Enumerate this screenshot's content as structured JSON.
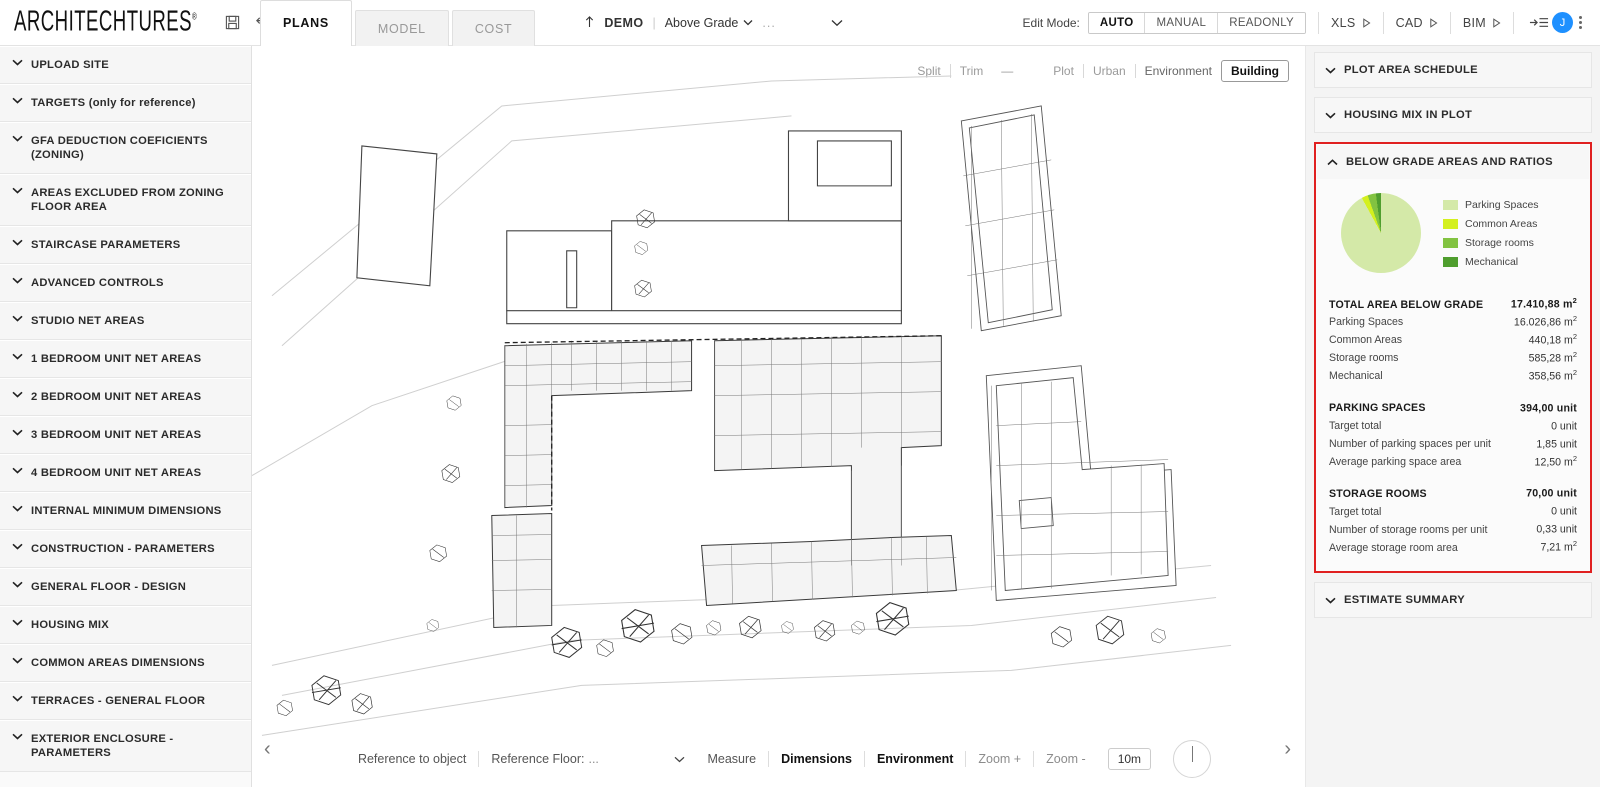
{
  "brand": {
    "name": "ARCHITECHTURES",
    "registered": "®"
  },
  "toolbar_icons": {
    "save": "save-icon",
    "undo": "undo-icon",
    "redo": "redo-icon"
  },
  "tabs": [
    {
      "label": "PLANS",
      "active": true
    },
    {
      "label": "MODEL",
      "active": false
    },
    {
      "label": "COST",
      "active": false
    }
  ],
  "project": {
    "upload_icon": "upload-arrow-icon",
    "name": "DEMO",
    "separator": "|",
    "grade": "Above Grade",
    "ellipsis": "...",
    "expand_icon": "chevron-down-icon"
  },
  "edit_mode": {
    "label": "Edit Mode:",
    "options": [
      {
        "label": "AUTO",
        "active": true
      },
      {
        "label": "MANUAL",
        "active": false
      },
      {
        "label": "READONLY",
        "active": false
      }
    ]
  },
  "exports": [
    {
      "label": "XLS"
    },
    {
      "label": "CAD"
    },
    {
      "label": "BIM"
    }
  ],
  "account": {
    "avatar_initial": "J",
    "menu_icon": "kebab-menu-icon",
    "collapse_icon": "collapse-panel-icon"
  },
  "sidebar": {
    "items": [
      {
        "label": "UPLOAD SITE"
      },
      {
        "label": "TARGETS (only for reference)"
      },
      {
        "label": "GFA DEDUCTION COEFICIENTS (ZONING)"
      },
      {
        "label": "AREAS EXCLUDED FROM ZONING FLOOR AREA"
      },
      {
        "label": "STAIRCASE PARAMETERS"
      },
      {
        "label": "ADVANCED CONTROLS"
      },
      {
        "label": "STUDIO NET AREAS"
      },
      {
        "label": "1 BEDROOM UNIT NET AREAS"
      },
      {
        "label": "2 BEDROOM UNIT NET AREAS"
      },
      {
        "label": "3 BEDROOM UNIT NET AREAS"
      },
      {
        "label": "4 BEDROOM UNIT NET AREAS"
      },
      {
        "label": "INTERNAL MINIMUM DIMENSIONS"
      },
      {
        "label": "CONSTRUCTION - PARAMETERS"
      },
      {
        "label": "GENERAL FLOOR - DESIGN"
      },
      {
        "label": "HOUSING MIX"
      },
      {
        "label": "COMMON AREAS DIMENSIONS"
      },
      {
        "label": "TERRACES - GENERAL FLOOR"
      },
      {
        "label": "EXTERIOR ENCLOSURE - PARAMETERS"
      }
    ]
  },
  "view_controls": {
    "split": "Split",
    "trim": "Trim",
    "dash": "—",
    "plot": "Plot",
    "urban": "Urban",
    "environment": "Environment",
    "building": "Building"
  },
  "bottom_bar": {
    "reference_to_object": "Reference to object",
    "reference_floor_label": "Reference Floor:",
    "reference_floor_value": "...",
    "dropdown_icon": "chevron-down-icon",
    "measure": "Measure",
    "dimensions": "Dimensions",
    "environment": "Environment",
    "zoom_in": "Zoom +",
    "zoom_out": "Zoom -",
    "scale": "10m",
    "compass": "compass-north-icon",
    "prev": "‹",
    "next": "›"
  },
  "right_panel": {
    "sections": [
      {
        "title": "PLOT AREA SCHEDULE",
        "expanded": false
      },
      {
        "title": "HOUSING MIX IN PLOT",
        "expanded": false
      },
      {
        "title": "BELOW GRADE AREAS AND RATIOS",
        "expanded": true,
        "highlighted": true
      },
      {
        "title": "ESTIMATE SUMMARY",
        "expanded": false
      }
    ],
    "below_grade": {
      "totals": {
        "header": {
          "key": "TOTAL AREA BELOW GRADE",
          "value": "17.410,88 m",
          "unit_sup": "2"
        },
        "rows": [
          {
            "key": "Parking Spaces",
            "value": "16.026,86 m",
            "unit_sup": "2"
          },
          {
            "key": "Common Areas",
            "value": "440,18 m",
            "unit_sup": "2"
          },
          {
            "key": "Storage rooms",
            "value": "585,28 m",
            "unit_sup": "2"
          },
          {
            "key": "Mechanical",
            "value": "358,56 m",
            "unit_sup": "2"
          }
        ]
      },
      "parking": {
        "header": {
          "key": "PARKING SPACES",
          "value": "394,00 unit",
          "unit_sup": ""
        },
        "rows": [
          {
            "key": "Target total",
            "value": "0 unit",
            "unit_sup": ""
          },
          {
            "key": "Number of parking spaces per unit",
            "value": "1,85 unit",
            "unit_sup": ""
          },
          {
            "key": "Average parking space area",
            "value": "12,50 m",
            "unit_sup": "2"
          }
        ]
      },
      "storage": {
        "header": {
          "key": "STORAGE ROOMS",
          "value": "70,00 unit",
          "unit_sup": ""
        },
        "rows": [
          {
            "key": "Target total",
            "value": "0 unit",
            "unit_sup": ""
          },
          {
            "key": "Number of storage rooms per unit",
            "value": "0,33 unit",
            "unit_sup": ""
          },
          {
            "key": "Average storage room area",
            "value": "7,21 m",
            "unit_sup": "2"
          }
        ]
      }
    }
  },
  "chart_data": {
    "type": "pie",
    "title": "BELOW GRADE AREAS AND RATIOS",
    "legend_position": "right",
    "categories": [
      "Parking Spaces",
      "Common Areas",
      "Storage rooms",
      "Mechanical"
    ],
    "values": [
      16026.86,
      440.18,
      585.28,
      358.56
    ],
    "unit": "m2",
    "total": 17410.88,
    "percentages": [
      92.05,
      2.53,
      3.36,
      2.06
    ],
    "colors": [
      "#d4e9a8",
      "#d4f01e",
      "#82c341",
      "#4f9e2e"
    ]
  }
}
